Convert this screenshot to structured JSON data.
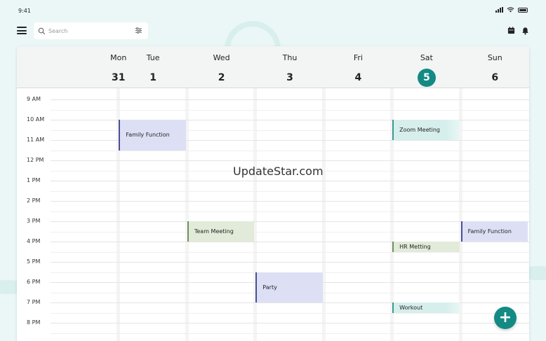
{
  "status": {
    "time": "9:41"
  },
  "search": {
    "placeholder": "Search"
  },
  "days": [
    {
      "name": "Mon",
      "num": "31"
    },
    {
      "name": "Tue",
      "num": "1"
    },
    {
      "name": "Wed",
      "num": "2"
    },
    {
      "name": "Thu",
      "num": "3"
    },
    {
      "name": "Fri",
      "num": "4"
    },
    {
      "name": "Sat",
      "num": "5"
    },
    {
      "name": "Sun",
      "num": "6"
    }
  ],
  "today_index": 5,
  "hours": [
    "9 AM",
    "10 AM",
    "11 AM",
    "12 PM",
    "1 PM",
    "2 PM",
    "3 PM",
    "4 PM",
    "5 PM",
    "6 PM",
    "7 PM",
    "8 PM"
  ],
  "events": [
    {
      "title": "Family Function",
      "day": 1,
      "start": 10.0,
      "end": 11.5,
      "style": "blue"
    },
    {
      "title": "Zoom Meeting",
      "day": 5,
      "start": 10.0,
      "end": 11.0,
      "style": "teal"
    },
    {
      "title": "Team Meeting",
      "day": 2,
      "start": 15.0,
      "end": 16.0,
      "style": "green"
    },
    {
      "title": "Family Function",
      "day": 6,
      "start": 15.0,
      "end": 16.0,
      "style": "blue"
    },
    {
      "title": "HR Metting",
      "day": 5,
      "start": 16.0,
      "end": 16.5,
      "style": "green"
    },
    {
      "title": "Party",
      "day": 3,
      "start": 17.5,
      "end": 19.0,
      "style": "blue"
    },
    {
      "title": "Workout",
      "day": 5,
      "start": 19.0,
      "end": 19.5,
      "style": "teal"
    }
  ],
  "watermark": "UpdateStar.com",
  "fab": {
    "label": "+"
  },
  "colors": {
    "accent": "#138a84"
  }
}
